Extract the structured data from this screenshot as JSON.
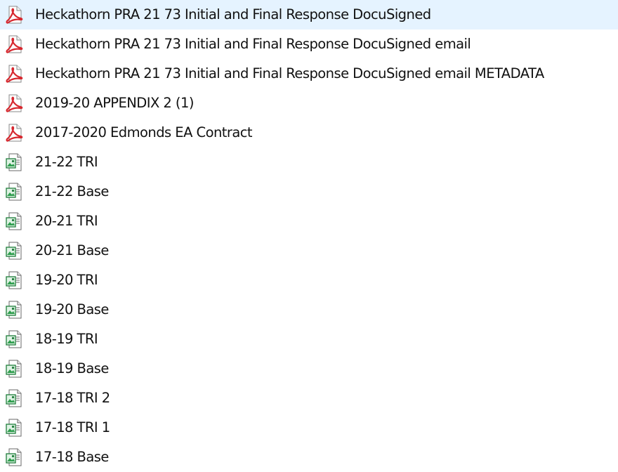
{
  "colors": {
    "selected_row_bg": "#e5f3ff",
    "pdf_icon": "#d7282f",
    "image_icon": "#1e7d3a"
  },
  "files": [
    {
      "name": "Heckathorn PRA 21 73 Initial and Final Response DocuSigned",
      "icon": "pdf-icon",
      "selected": true
    },
    {
      "name": "Heckathorn PRA 21 73 Initial and Final Response DocuSigned email",
      "icon": "pdf-icon",
      "selected": false
    },
    {
      "name": "Heckathorn PRA 21 73 Initial and Final Response DocuSigned email METADATA",
      "icon": "pdf-icon",
      "selected": false
    },
    {
      "name": "2019-20 APPENDIX 2 (1)",
      "icon": "pdf-icon",
      "selected": false
    },
    {
      "name": "2017-2020 Edmonds EA Contract",
      "icon": "pdf-icon",
      "selected": false
    },
    {
      "name": "21-22 TRI",
      "icon": "image-file-icon",
      "selected": false
    },
    {
      "name": "21-22 Base",
      "icon": "image-file-icon",
      "selected": false
    },
    {
      "name": "20-21 TRI",
      "icon": "image-file-icon",
      "selected": false
    },
    {
      "name": "20-21 Base",
      "icon": "image-file-icon",
      "selected": false
    },
    {
      "name": "19-20 TRI",
      "icon": "image-file-icon",
      "selected": false
    },
    {
      "name": "19-20 Base",
      "icon": "image-file-icon",
      "selected": false
    },
    {
      "name": "18-19 TRI",
      "icon": "image-file-icon",
      "selected": false
    },
    {
      "name": "18-19 Base",
      "icon": "image-file-icon",
      "selected": false
    },
    {
      "name": "17-18 TRI 2",
      "icon": "image-file-icon",
      "selected": false
    },
    {
      "name": "17-18 TRI 1",
      "icon": "image-file-icon",
      "selected": false
    },
    {
      "name": "17-18 Base",
      "icon": "image-file-icon",
      "selected": false
    }
  ]
}
